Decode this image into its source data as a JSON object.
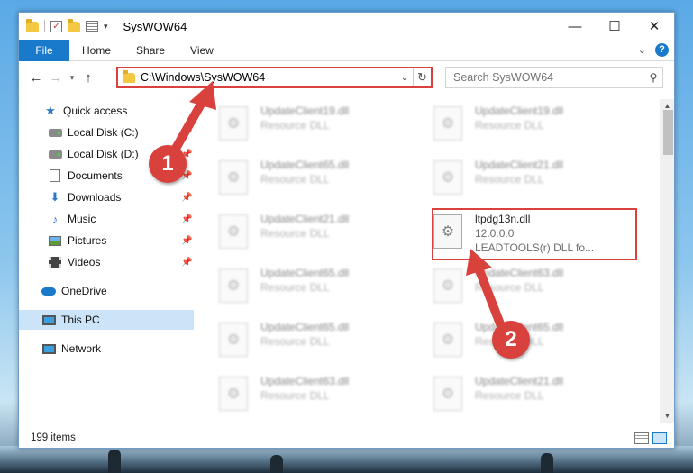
{
  "window": {
    "title": "SysWOW64",
    "controls": {
      "minimize": "—",
      "maximize": "☐",
      "close": "✕"
    }
  },
  "ribbon": {
    "tabs": [
      "File",
      "Home",
      "Share",
      "View"
    ]
  },
  "address": {
    "path": "C:\\Windows\\SysWOW64",
    "search_placeholder": "Search SysWOW64"
  },
  "sidebar": {
    "items": [
      {
        "label": "Quick access",
        "icon": "star-icon",
        "pinned": false
      },
      {
        "label": "Local Disk (C:)",
        "icon": "drive-icon",
        "pinned": true
      },
      {
        "label": "Local Disk (D:)",
        "icon": "drive-icon",
        "pinned": true
      },
      {
        "label": "Documents",
        "icon": "documents-icon",
        "pinned": true
      },
      {
        "label": "Downloads",
        "icon": "downloads-icon",
        "pinned": true
      },
      {
        "label": "Music",
        "icon": "music-icon",
        "pinned": true
      },
      {
        "label": "Pictures",
        "icon": "pictures-icon",
        "pinned": true
      },
      {
        "label": "Videos",
        "icon": "videos-icon",
        "pinned": true
      },
      {
        "label": "OneDrive",
        "icon": "onedrive-icon",
        "pinned": false
      },
      {
        "label": "This PC",
        "icon": "this-pc-icon",
        "pinned": false,
        "selected": true
      },
      {
        "label": "Network",
        "icon": "network-icon",
        "pinned": false
      }
    ]
  },
  "files": [
    {
      "name": "UpdateClient19.dll",
      "meta1": "Resource DLL",
      "meta2": "",
      "blurred": true
    },
    {
      "name": "UpdateClient19.dll",
      "meta1": "Resource DLL",
      "meta2": "",
      "blurred": true
    },
    {
      "name": "UpdateClient65.dll",
      "meta1": "Resource DLL",
      "meta2": "",
      "blurred": true
    },
    {
      "name": "UpdateClient21.dll",
      "meta1": "Resource DLL",
      "meta2": "",
      "blurred": true
    },
    {
      "name": "UpdateClient21.dll",
      "meta1": "Resource DLL",
      "meta2": "",
      "blurred": true
    },
    {
      "name": "ltpdg13n.dll",
      "meta1": "12.0.0.0",
      "meta2": "LEADTOOLS(r) DLL fo...",
      "blurred": false
    },
    {
      "name": "UpdateClient65.dll",
      "meta1": "Resource DLL",
      "meta2": "",
      "blurred": true
    },
    {
      "name": "UpdateClient63.dll",
      "meta1": "Resource DLL",
      "meta2": "",
      "blurred": true
    },
    {
      "name": "UpdateClient65.dll",
      "meta1": "Resource DLL",
      "meta2": "",
      "blurred": true
    },
    {
      "name": "UpdateClient65.dll",
      "meta1": "Resource DLL",
      "meta2": "",
      "blurred": true
    },
    {
      "name": "UpdateClient63.dll",
      "meta1": "Resource DLL",
      "meta2": "",
      "blurred": true
    },
    {
      "name": "UpdateClient21.dll",
      "meta1": "Resource DLL",
      "meta2": "",
      "blurred": true
    }
  ],
  "status": {
    "item_count": "199 items"
  },
  "annotations": {
    "step1": "1",
    "step2": "2",
    "color": "#d9413d"
  }
}
